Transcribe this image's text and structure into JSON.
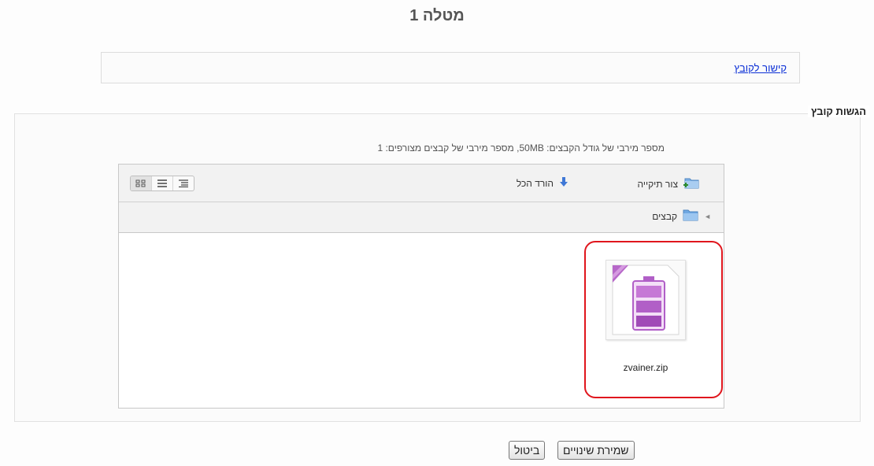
{
  "page": {
    "title": "מטלה 1",
    "file_link": "קישור לקובץ"
  },
  "submission": {
    "legend": "הגשות קובץ",
    "limits": "מספר מירבי של גודל הקבצים: 50MB, מספר מירבי של קבצים מצורפים: 1"
  },
  "filemanager": {
    "create_folder": "צור תיקייה",
    "download_all": "הורד הכל",
    "breadcrumb": "קבצים",
    "files": [
      {
        "name": "zvainer.zip",
        "icon": "zip-archive-icon"
      }
    ],
    "view_modes": [
      "icons",
      "list",
      "tree"
    ]
  },
  "buttons": {
    "save": "שמירת שינויים",
    "cancel": "ביטול"
  },
  "colors": {
    "link": "#0b2fd6",
    "highlight": "#e0161d",
    "zip_icon": "#b15fc7"
  }
}
